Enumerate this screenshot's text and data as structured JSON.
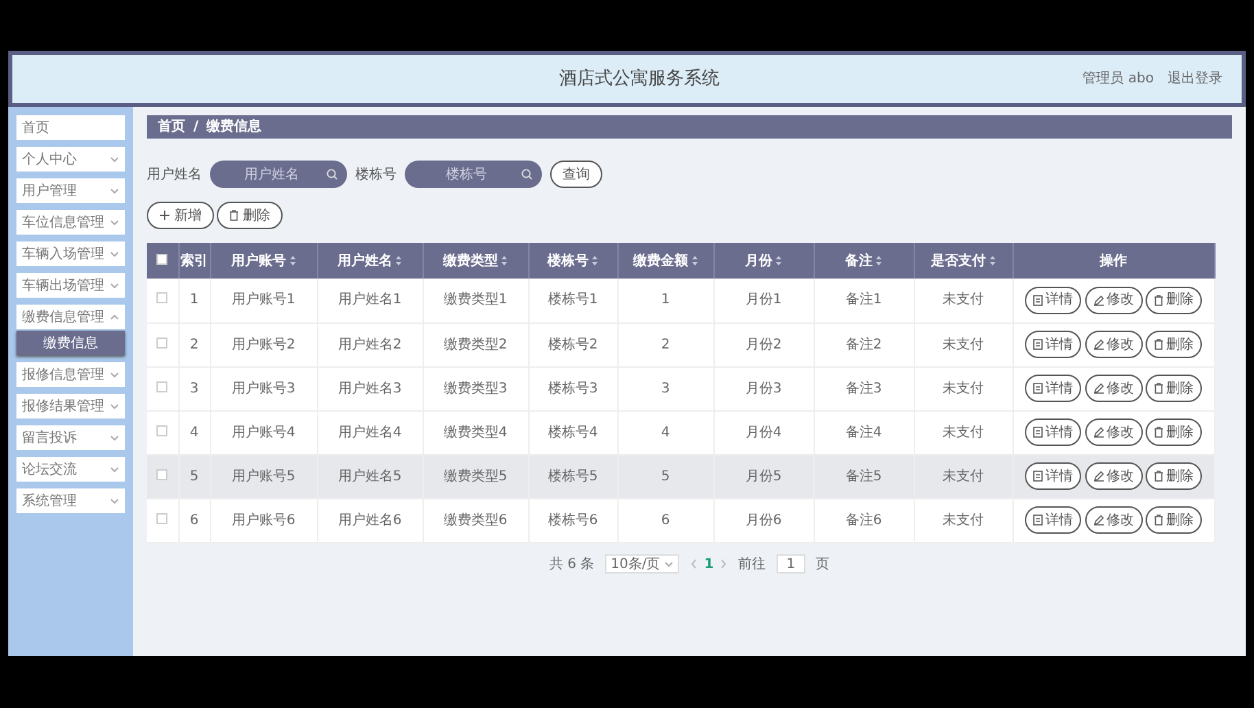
{
  "header": {
    "title": "酒店式公寓服务系统",
    "user": "管理员 abo",
    "logout": "退出登录"
  },
  "sidebar": {
    "items": [
      {
        "label": "首页",
        "kind": "link"
      },
      {
        "label": "个人中心",
        "kind": "menu",
        "expanded": false
      },
      {
        "label": "用户管理",
        "kind": "menu",
        "expanded": false
      },
      {
        "label": "车位信息管理",
        "kind": "menu",
        "expanded": false
      },
      {
        "label": "车辆入场管理",
        "kind": "menu",
        "expanded": false
      },
      {
        "label": "车辆出场管理",
        "kind": "menu",
        "expanded": false
      },
      {
        "label": "缴费信息管理",
        "kind": "menu",
        "expanded": true,
        "children": [
          {
            "label": "缴费信息",
            "selected": true
          }
        ]
      },
      {
        "label": "报修信息管理",
        "kind": "menu",
        "expanded": false
      },
      {
        "label": "报修结果管理",
        "kind": "menu",
        "expanded": false
      },
      {
        "label": "留言投诉",
        "kind": "menu",
        "expanded": false
      },
      {
        "label": "论坛交流",
        "kind": "menu",
        "expanded": false
      },
      {
        "label": "系统管理",
        "kind": "menu",
        "expanded": false
      }
    ]
  },
  "breadcrumb": {
    "items": [
      "首页",
      "缴费信息"
    ],
    "separator": "/"
  },
  "search": {
    "fields": [
      {
        "label": "用户姓名",
        "placeholder": "用户姓名"
      },
      {
        "label": "楼栋号",
        "placeholder": "楼栋号"
      }
    ],
    "button": "查询"
  },
  "actions": [
    {
      "label": "新增",
      "kind": "add"
    },
    {
      "label": "删除",
      "kind": "delete"
    }
  ],
  "table": {
    "select_all": {
      "checked": false
    },
    "columns": [
      {
        "label": "索引",
        "sortable": false
      },
      {
        "label": "用户账号",
        "sortable": true
      },
      {
        "label": "用户姓名",
        "sortable": true
      },
      {
        "label": "缴费类型",
        "sortable": true
      },
      {
        "label": "楼栋号",
        "sortable": true
      },
      {
        "label": "缴费金额",
        "sortable": true
      },
      {
        "label": "月份",
        "sortable": true
      },
      {
        "label": "备注",
        "sortable": true
      },
      {
        "label": "是否支付",
        "sortable": true
      },
      {
        "label": "操作",
        "sortable": false
      }
    ],
    "rows": [
      {
        "checked": false,
        "highlighted": false,
        "cells": [
          "1",
          "用户账号1",
          "用户姓名1",
          "缴费类型1",
          "楼栋号1",
          "1",
          "月份1",
          "备注1",
          "未支付"
        ],
        "buttons": [
          {
            "label": "详情",
            "kind": "detail"
          },
          {
            "label": "修改",
            "kind": "edit"
          },
          {
            "label": "删除",
            "kind": "delete"
          }
        ]
      },
      {
        "checked": false,
        "highlighted": false,
        "cells": [
          "2",
          "用户账号2",
          "用户姓名2",
          "缴费类型2",
          "楼栋号2",
          "2",
          "月份2",
          "备注2",
          "未支付"
        ],
        "buttons": [
          {
            "label": "详情",
            "kind": "detail"
          },
          {
            "label": "修改",
            "kind": "edit"
          },
          {
            "label": "删除",
            "kind": "delete"
          }
        ]
      },
      {
        "checked": false,
        "highlighted": false,
        "cells": [
          "3",
          "用户账号3",
          "用户姓名3",
          "缴费类型3",
          "楼栋号3",
          "3",
          "月份3",
          "备注3",
          "未支付"
        ],
        "buttons": [
          {
            "label": "详情",
            "kind": "detail"
          },
          {
            "label": "修改",
            "kind": "edit"
          },
          {
            "label": "删除",
            "kind": "delete"
          }
        ]
      },
      {
        "checked": false,
        "highlighted": false,
        "cells": [
          "4",
          "用户账号4",
          "用户姓名4",
          "缴费类型4",
          "楼栋号4",
          "4",
          "月份4",
          "备注4",
          "未支付"
        ],
        "buttons": [
          {
            "label": "详情",
            "kind": "detail"
          },
          {
            "label": "修改",
            "kind": "edit"
          },
          {
            "label": "删除",
            "kind": "delete"
          }
        ]
      },
      {
        "checked": false,
        "highlighted": true,
        "cells": [
          "5",
          "用户账号5",
          "用户姓名5",
          "缴费类型5",
          "楼栋号5",
          "5",
          "月份5",
          "备注5",
          "未支付"
        ],
        "buttons": [
          {
            "label": "详情",
            "kind": "detail"
          },
          {
            "label": "修改",
            "kind": "edit"
          },
          {
            "label": "删除",
            "kind": "delete"
          }
        ]
      },
      {
        "checked": false,
        "highlighted": false,
        "cells": [
          "6",
          "用户账号6",
          "用户姓名6",
          "缴费类型6",
          "楼栋号6",
          "6",
          "月份6",
          "备注6",
          "未支付"
        ],
        "buttons": [
          {
            "label": "详情",
            "kind": "detail"
          },
          {
            "label": "修改",
            "kind": "edit"
          },
          {
            "label": "删除",
            "kind": "delete"
          }
        ]
      }
    ]
  },
  "pagination": {
    "total": "共 6 条",
    "page_size": "10条/页",
    "pages": [
      {
        "label": "1",
        "selected": true
      }
    ],
    "goto_label": "前往",
    "goto_value": "1",
    "goto_suffix": "页"
  }
}
